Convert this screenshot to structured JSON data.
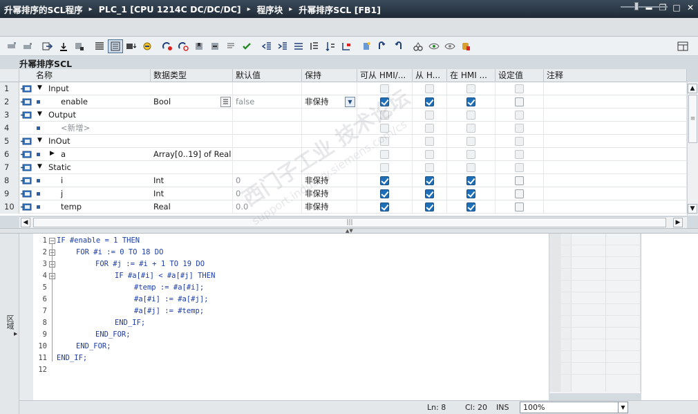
{
  "window": {
    "breadcrumbs": [
      "升幂排序的SCL程序",
      "PLC_1 [CPU 1214C DC/DC/DC]",
      "程序块",
      "升幂排序SCL [FB1]"
    ],
    "separator": "▸",
    "controls": [
      "minimize",
      "restore",
      "maximize",
      "close"
    ]
  },
  "block_title": "升幂排序SCL",
  "table": {
    "headers": [
      "名称",
      "数据类型",
      "默认值",
      "保持",
      "可从 HMI/...",
      "从 H...",
      "在 HMI ...",
      "设定值",
      "注释"
    ],
    "rows": [
      {
        "num": "1",
        "name": "Input",
        "type": "",
        "default": "",
        "retain": "",
        "section": true,
        "hmi": [
          false,
          false,
          false
        ],
        "setpoint": false,
        "disabled": true
      },
      {
        "num": "2",
        "name": "enable",
        "type": "Bool",
        "default": "false",
        "retain": "非保持",
        "section": false,
        "hmi": [
          true,
          true,
          true
        ],
        "setpoint": false,
        "disabled": false
      },
      {
        "num": "3",
        "name": "Output",
        "type": "",
        "default": "",
        "retain": "",
        "section": true,
        "hmi": [
          false,
          false,
          false
        ],
        "setpoint": false,
        "disabled": true
      },
      {
        "num": "4",
        "name": "<新增>",
        "type": "",
        "default": "",
        "retain": "",
        "section": false,
        "hmi": [
          false,
          false,
          false
        ],
        "setpoint": false,
        "disabled": true
      },
      {
        "num": "5",
        "name": "InOut",
        "type": "",
        "default": "",
        "retain": "",
        "section": true,
        "hmi": [
          false,
          false,
          false
        ],
        "setpoint": false,
        "disabled": true
      },
      {
        "num": "6",
        "name": "a",
        "type": "Array[0..19] of Real",
        "default": "",
        "retain": "",
        "section": false,
        "hmi": [
          false,
          false,
          false
        ],
        "setpoint": false,
        "disabled": true
      },
      {
        "num": "7",
        "name": "Static",
        "type": "",
        "default": "",
        "retain": "",
        "section": true,
        "hmi": [
          false,
          false,
          false
        ],
        "setpoint": false,
        "disabled": true
      },
      {
        "num": "8",
        "name": "i",
        "type": "Int",
        "default": "0",
        "retain": "非保持",
        "section": false,
        "hmi": [
          true,
          true,
          true
        ],
        "setpoint": false,
        "disabled": false
      },
      {
        "num": "9",
        "name": "j",
        "type": "Int",
        "default": "0",
        "retain": "非保持",
        "section": false,
        "hmi": [
          true,
          true,
          true
        ],
        "setpoint": false,
        "disabled": false
      },
      {
        "num": "10",
        "name": "temp",
        "type": "Real",
        "default": "0.0",
        "retain": "非保持",
        "section": false,
        "hmi": [
          true,
          true,
          true
        ],
        "setpoint": false,
        "disabled": false
      }
    ]
  },
  "code": [
    {
      "n": "1",
      "text": "IF #enable = 1 THEN",
      "indent": 0,
      "fold": true
    },
    {
      "n": "2",
      "text": "FOR #i := 0 TO 18 DO",
      "indent": 1,
      "fold": true
    },
    {
      "n": "3",
      "text": "FOR #j := #i + 1 TO 19 DO",
      "indent": 2,
      "fold": true
    },
    {
      "n": "4",
      "text": "IF #a[#i] < #a[#j] THEN",
      "indent": 3,
      "fold": true
    },
    {
      "n": "5",
      "text": "#temp := #a[#i];",
      "indent": 4,
      "fold": false
    },
    {
      "n": "6",
      "text": "#a[#i] := #a[#j];",
      "indent": 4,
      "fold": false
    },
    {
      "n": "7",
      "text": "#a[#j] := #temp;",
      "indent": 4,
      "fold": false
    },
    {
      "n": "8",
      "text": "END_IF;",
      "indent": 3,
      "fold": false
    },
    {
      "n": "9",
      "text": "END_FOR;",
      "indent": 2,
      "fold": false
    },
    {
      "n": "10",
      "text": "END_FOR;",
      "indent": 1,
      "fold": false
    },
    {
      "n": "11",
      "text": "END_IF;",
      "indent": 0,
      "fold": false
    },
    {
      "n": "12",
      "text": "",
      "indent": 0,
      "fold": false
    }
  ],
  "sidebar_label": "区域",
  "status": {
    "line": "Ln: 8",
    "col": "Cl: 20",
    "mode": "INS",
    "zoom": "100%"
  },
  "watermark": {
    "cn": "西门子工业  技术论坛",
    "url": "support.industry.siemens.com/cs"
  },
  "colors": {
    "titlebar": "#1f2a36",
    "accent": "#1e6fb8",
    "code_keyword": "#1a3ca8"
  }
}
